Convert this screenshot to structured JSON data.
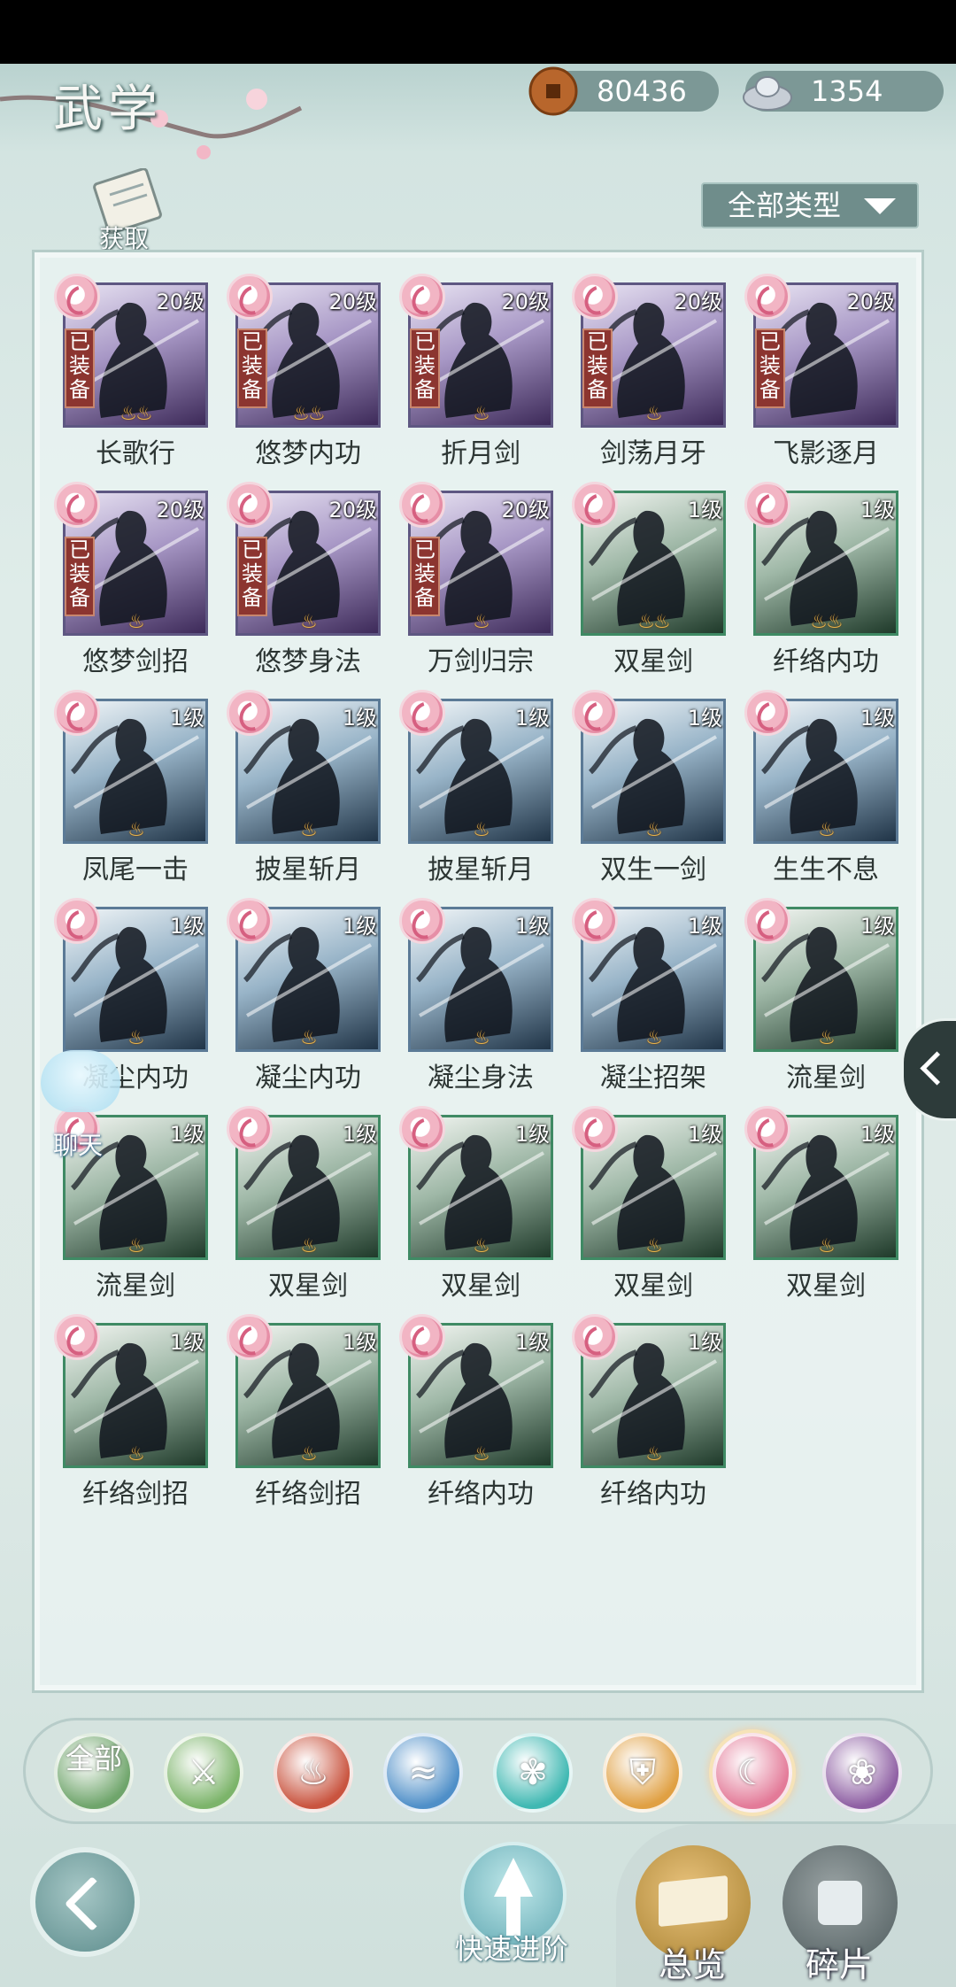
{
  "header": {
    "title": "武学",
    "coins": "80436",
    "silver": "1354",
    "acquire_label": "获取",
    "filter_label": "全部类型"
  },
  "skills": [
    {
      "name": "长歌行",
      "level": "20级",
      "equipped": true,
      "flames": "♨♨",
      "tone": "purple"
    },
    {
      "name": "悠梦内功",
      "level": "20级",
      "equipped": true,
      "flames": "♨♨",
      "tone": "purple"
    },
    {
      "name": "折月剑",
      "level": "20级",
      "equipped": true,
      "flames": "♨",
      "tone": "purple"
    },
    {
      "name": "剑荡月牙",
      "level": "20级",
      "equipped": true,
      "flames": "♨",
      "tone": "purple"
    },
    {
      "name": "飞影逐月",
      "level": "20级",
      "equipped": true,
      "flames": "",
      "tone": "purple"
    },
    {
      "name": "悠梦剑招",
      "level": "20级",
      "equipped": true,
      "flames": "♨",
      "tone": "purple"
    },
    {
      "name": "悠梦身法",
      "level": "20级",
      "equipped": true,
      "flames": "♨",
      "tone": "purple"
    },
    {
      "name": "万剑归宗",
      "level": "20级",
      "equipped": true,
      "flames": "♨",
      "tone": "purple"
    },
    {
      "name": "双星剑",
      "level": "1级",
      "equipped": false,
      "flames": "♨♨",
      "tone": "green"
    },
    {
      "name": "纤络内功",
      "level": "1级",
      "equipped": false,
      "flames": "♨♨",
      "tone": "green"
    },
    {
      "name": "凤尾一击",
      "level": "1级",
      "equipped": false,
      "flames": "♨",
      "tone": "blue"
    },
    {
      "name": "披星斩月",
      "level": "1级",
      "equipped": false,
      "flames": "♨",
      "tone": "blue"
    },
    {
      "name": "披星斩月",
      "level": "1级",
      "equipped": false,
      "flames": "♨",
      "tone": "blue"
    },
    {
      "name": "双生一剑",
      "level": "1级",
      "equipped": false,
      "flames": "♨",
      "tone": "blue"
    },
    {
      "name": "生生不息",
      "level": "1级",
      "equipped": false,
      "flames": "♨",
      "tone": "blue"
    },
    {
      "name": "凝尘内功",
      "level": "1级",
      "equipped": false,
      "flames": "♨",
      "tone": "blue"
    },
    {
      "name": "凝尘内功",
      "level": "1级",
      "equipped": false,
      "flames": "♨",
      "tone": "blue"
    },
    {
      "name": "凝尘身法",
      "level": "1级",
      "equipped": false,
      "flames": "♨",
      "tone": "blue"
    },
    {
      "name": "凝尘招架",
      "level": "1级",
      "equipped": false,
      "flames": "♨",
      "tone": "blue"
    },
    {
      "name": "流星剑",
      "level": "1级",
      "equipped": false,
      "flames": "♨",
      "tone": "green"
    },
    {
      "name": "流星剑",
      "level": "1级",
      "equipped": false,
      "flames": "♨",
      "tone": "green"
    },
    {
      "name": "双星剑",
      "level": "1级",
      "equipped": false,
      "flames": "♨",
      "tone": "green"
    },
    {
      "name": "双星剑",
      "level": "1级",
      "equipped": false,
      "flames": "♨",
      "tone": "green"
    },
    {
      "name": "双星剑",
      "level": "1级",
      "equipped": false,
      "flames": "♨",
      "tone": "green"
    },
    {
      "name": "双星剑",
      "level": "1级",
      "equipped": false,
      "flames": "♨",
      "tone": "green"
    },
    {
      "name": "纤络剑招",
      "level": "1级",
      "equipped": false,
      "flames": "♨",
      "tone": "green"
    },
    {
      "name": "纤络剑招",
      "level": "1级",
      "equipped": false,
      "flames": "♨",
      "tone": "green"
    },
    {
      "name": "纤络内功",
      "level": "1级",
      "equipped": false,
      "flames": "♨",
      "tone": "green"
    },
    {
      "name": "纤络内功",
      "level": "1级",
      "equipped": false,
      "flames": "♨",
      "tone": "green"
    }
  ],
  "equipped_label": "已装备",
  "chat_label": "聊天",
  "categories": [
    {
      "id": "all",
      "glyph": "全部",
      "color": "#6fa56b",
      "selected": false
    },
    {
      "id": "sword",
      "glyph": "⚔",
      "color": "#7cb46a",
      "selected": false
    },
    {
      "id": "fire",
      "glyph": "♨",
      "color": "#c9543f",
      "selected": false
    },
    {
      "id": "wave",
      "glyph": "≈",
      "color": "#4f8fc8",
      "selected": false
    },
    {
      "id": "butterfly",
      "glyph": "✾",
      "color": "#3fb8b2",
      "selected": false
    },
    {
      "id": "shield",
      "glyph": "⛨",
      "color": "#e0a043",
      "selected": false
    },
    {
      "id": "moon",
      "glyph": "☾",
      "color": "#e37a98",
      "selected": true
    },
    {
      "id": "rose",
      "glyph": "❀",
      "color": "#8e5fa3",
      "selected": false
    }
  ],
  "bottom": {
    "quick_advance_label": "快速进阶",
    "overview_label": "总览",
    "fragments_label": "碎片"
  }
}
